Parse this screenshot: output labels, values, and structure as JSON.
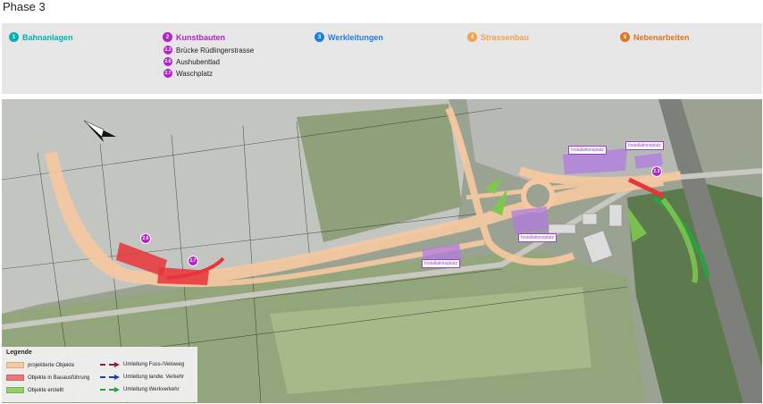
{
  "title": "Phase 3",
  "categories": [
    {
      "number": "1",
      "label": "Bahnanlagen",
      "color": "#00b3b3"
    },
    {
      "number": "2",
      "label": "Kunstbauten",
      "color": "#b521c8"
    },
    {
      "number": "3",
      "label": "Werkleitungen",
      "color": "#1f7fe0"
    },
    {
      "number": "4",
      "label": "Strassenbau",
      "color": "#f5a24b"
    },
    {
      "number": "5",
      "label": "Nebenarbeiten",
      "color": "#e0761f"
    }
  ],
  "kunstbauten_items": [
    {
      "number": "2.3",
      "label": "Brücke Rüdlingerstrasse"
    },
    {
      "number": "2.6",
      "label": "Aushubentlad"
    },
    {
      "number": "2.7",
      "label": "Waschplatz"
    }
  ],
  "map": {
    "installation_labels": [
      "Installationsplatz",
      "Installationsplatz",
      "Installationsplatz",
      "Installationsplatz"
    ],
    "markers": [
      "2.6",
      "2.7",
      "2.3"
    ],
    "north_arrow_icon": "north-arrow-icon",
    "colors": {
      "projected": "#f7c9a0",
      "construction": "#e8343a",
      "built": "#7ec850",
      "installation": "#9a3fc9"
    }
  },
  "legend": {
    "title": "Legende",
    "items": [
      {
        "label": "projektierte Objekte",
        "color": "#f7c9a0"
      },
      {
        "label": "Objekte in Bauausführung",
        "color": "#e8787c"
      },
      {
        "label": "Objekte erstellt",
        "color": "#8fd068"
      }
    ],
    "detours": [
      {
        "label": "Umleitung Fuss-/Veloweg",
        "color": "#8b1a4a"
      },
      {
        "label": "Umleitung landw. Verkehr",
        "color": "#1f3fb0"
      },
      {
        "label": "Umleitung Werkverkehr",
        "color": "#2aa040"
      }
    ]
  }
}
